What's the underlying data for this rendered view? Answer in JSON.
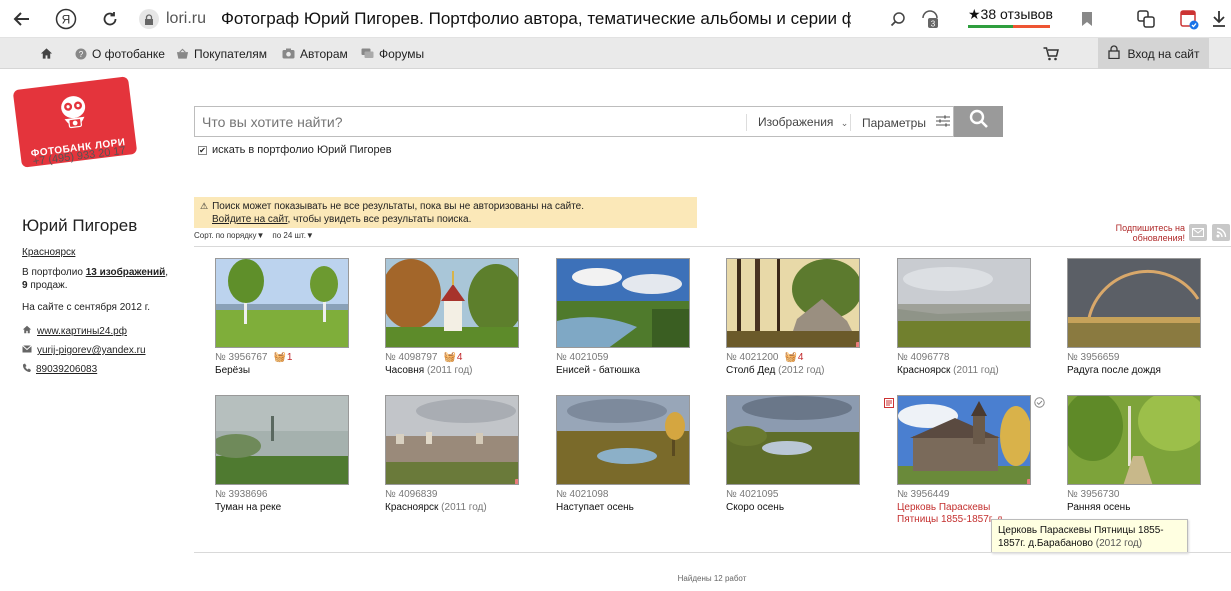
{
  "browser": {
    "domain": "lori.ru",
    "tab_title": "Фотограф Юрий Пигорев. Портфолио автора, тематические альбомы и серии фотог...",
    "reviews_label": "★38 отзывов",
    "ext_badge": "3"
  },
  "nav": {
    "about": "О фотобанке",
    "buyers": "Покупателям",
    "authors": "Авторам",
    "forums": "Форумы",
    "login": "Вход на сайт"
  },
  "logo": {
    "text": "ФОТОБАНК ЛОРИ",
    "phone": "+7 (495) 933 20 17"
  },
  "search": {
    "placeholder": "Что вы хотите найти?",
    "type": "Изображения",
    "params": "Параметры",
    "portfolio_check": "искать в портфолио Юрий Пигорев"
  },
  "author": {
    "name": "Юрий Пигорев",
    "city": "Красноярск",
    "in_portfolio_prefix": "В портфолио ",
    "count_images": "13 изображений",
    "sales_count": "9",
    "sales_suffix": " продаж.",
    "since": "На сайте с сентября 2012 г.",
    "website": "www.картины24.рф",
    "email": "yurij-pigorev@yandex.ru",
    "phone": "89039206083"
  },
  "notice": {
    "line1": "Поиск может показывать не все результаты, пока вы не авторизованы на сайте.",
    "link": "Войдите на сайт",
    "line2_rest": ", чтобы увидеть все результаты поиска."
  },
  "sort": {
    "order": "Сорт. по порядку▼",
    "per_page": "по 24 шт.▼"
  },
  "subscribe": {
    "line1": "Подпишитесь на",
    "line2": "обновления!"
  },
  "photos": [
    {
      "id": "№ 3956767",
      "sales": "1",
      "title": "Берёзы",
      "year": ""
    },
    {
      "id": "№ 4098797",
      "sales": "4",
      "title": "Часовня",
      "year": "(2011 год)"
    },
    {
      "id": "№ 4021059",
      "sales": "",
      "title": "Енисей - батюшка",
      "year": ""
    },
    {
      "id": "№ 4021200",
      "sales": "4",
      "title": "Столб Дед",
      "year": "(2012 год)"
    },
    {
      "id": "№ 4096778",
      "sales": "",
      "title": "Красноярск",
      "year": "(2011 год)"
    },
    {
      "id": "№ 3956659",
      "sales": "",
      "title": "Радуга после дождя",
      "year": ""
    },
    {
      "id": "№ 3938696",
      "sales": "",
      "title": "Туман на реке",
      "year": ""
    },
    {
      "id": "№ 4096839",
      "sales": "",
      "title": "Красноярск",
      "year": "(2011 год)"
    },
    {
      "id": "№ 4021098",
      "sales": "",
      "title": "Наступает осень",
      "year": ""
    },
    {
      "id": "№ 4021095",
      "sales": "",
      "title": "Скоро осень",
      "year": ""
    },
    {
      "id": "№ 3956449",
      "sales": "",
      "title": "Церковь Параскевы Пятницы 1855-1857г. д...",
      "year": ""
    },
    {
      "id": "№ 3956730",
      "sales": "",
      "title": "Ранняя осень",
      "year": ""
    }
  ],
  "tooltip": {
    "text": "Церковь Параскевы Пятницы 1855-1857г. д.Барабаново",
    "year": "(2012 год)"
  },
  "found": "Найдены 12 работ",
  "colors": {
    "accent": "#e4343c",
    "notice_bg": "#fbe8b8",
    "link_red": "#c4302f"
  }
}
